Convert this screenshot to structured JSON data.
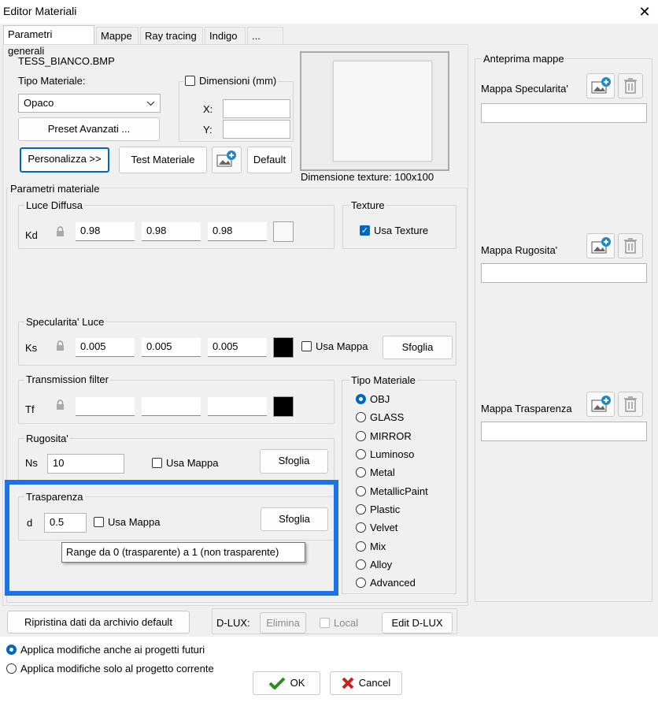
{
  "window": {
    "title": "Editor Materiali",
    "close_glyph": "✕"
  },
  "tabs": [
    "Parametri generali",
    "Mappe",
    "Ray tracing",
    "Indigo",
    "..."
  ],
  "general": {
    "texture_name": "TESS_BIANCO.BMP",
    "material_type_label": "Tipo Materiale:",
    "material_type_value": "Opaco",
    "preset_button": "Preset Avanzati ...",
    "customize_button": "Personalizza >>",
    "test_button": "Test Materiale",
    "default_button": "Default",
    "dimensions_label": "Dimensioni (mm)",
    "x_label": "X:",
    "y_label": "Y:",
    "texture_dimension": "Dimensione texture:  100x100"
  },
  "params": {
    "group_label": "Parametri materiale",
    "diffuse": {
      "label": "Luce Diffusa",
      "prefix": "Kd",
      "values": [
        "0.98",
        "0.98",
        "0.98"
      ],
      "color": "#f8f8f8"
    },
    "texture": {
      "label": "Texture",
      "use_texture": "Usa Texture"
    },
    "specular": {
      "label": "Specularita' Luce",
      "prefix": "Ks",
      "values": [
        "0.005",
        "0.005",
        "0.005"
      ],
      "use_map": "Usa Mappa",
      "browse": "Sfoglia",
      "color": "#000000"
    },
    "transmission": {
      "label": "Transmission filter",
      "prefix": "Tf",
      "color": "#000000"
    },
    "roughness": {
      "label": "Rugosita'",
      "prefix": "Ns",
      "value": "10",
      "use_map": "Usa Mappa",
      "browse": "Sfoglia"
    },
    "transparency": {
      "label": "Trasparenza",
      "prefix": "d",
      "value": "0.5",
      "use_map": "Usa Mappa",
      "browse": "Sfoglia",
      "tooltip": "Range da 0 (trasparente) a 1 (non trasparente)"
    },
    "material_kind": {
      "label": "Tipo Materiale",
      "options": [
        "OBJ",
        "GLASS",
        "MIRROR",
        "Luminoso",
        "Metal",
        "MetallicPaint",
        "Plastic",
        "Velvet",
        "Mix",
        "Alloy",
        "Advanced"
      ],
      "selected": "OBJ"
    }
  },
  "maps": {
    "group_label": "Anteprima mappe",
    "items": [
      "Mappa Specularita'",
      "Mappa Rugosita'",
      "Mappa Trasparenza"
    ]
  },
  "footer": {
    "restore_button": "Ripristina dati da archivio default",
    "dlux_label": "D-LUX:",
    "delete_button": "Elimina",
    "local_label": "Local",
    "edit_button": "Edit D-LUX",
    "apply_future": "Applica modifiche anche ai progetti futuri",
    "apply_current": "Applica modifiche solo al progetto corrente",
    "ok_button": "OK",
    "cancel_button": "Cancel"
  },
  "colors": {
    "accent": "#0067c0",
    "highlight": "#1a73e8"
  },
  "icons": [
    "close-icon",
    "chevron-down-icon",
    "image-add-icon",
    "trash-icon",
    "lock-icon",
    "check-icon",
    "cross-icon"
  ]
}
